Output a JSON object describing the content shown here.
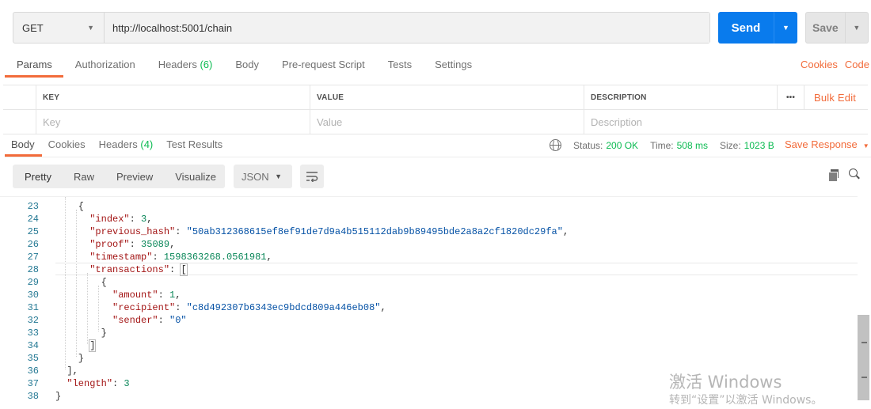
{
  "request": {
    "method": "GET",
    "url": "http://localhost:5001/chain",
    "send_label": "Send",
    "save_label": "Save"
  },
  "request_tabs": [
    {
      "label": "Params"
    },
    {
      "label": "Authorization"
    },
    {
      "label": "Headers",
      "count": "(6)"
    },
    {
      "label": "Body"
    },
    {
      "label": "Pre-request Script"
    },
    {
      "label": "Tests"
    },
    {
      "label": "Settings"
    }
  ],
  "request_tabs_right": {
    "cookies": "Cookies",
    "code": "Code"
  },
  "params": {
    "headers": {
      "key": "KEY",
      "value": "VALUE",
      "description": "DESCRIPTION"
    },
    "more": "•••",
    "bulk_edit": "Bulk Edit",
    "placeholders": {
      "key": "Key",
      "value": "Value",
      "description": "Description"
    }
  },
  "response_tabs": [
    {
      "label": "Body"
    },
    {
      "label": "Cookies"
    },
    {
      "label": "Headers",
      "count": "(4)"
    },
    {
      "label": "Test Results"
    }
  ],
  "response_meta": {
    "status_label": "Status:",
    "status_value": "200 OK",
    "time_label": "Time:",
    "time_value": "508 ms",
    "size_label": "Size:",
    "size_value": "1023 B",
    "save_response": "Save Response"
  },
  "view_modes": [
    "Pretty",
    "Raw",
    "Preview",
    "Visualize"
  ],
  "format": "JSON",
  "code_lines": [
    {
      "num": "23",
      "text": "    {"
    },
    {
      "num": "24",
      "text": "      \"index\": 3,"
    },
    {
      "num": "25",
      "text": "      \"previous_hash\": \"50ab312368615ef8ef91de7d9a4b515112dab9b89495bde2a8a2cf1820dc29fa\","
    },
    {
      "num": "26",
      "text": "      \"proof\": 35089,"
    },
    {
      "num": "27",
      "text": "      \"timestamp\": 1598363268.0561981,"
    },
    {
      "num": "28",
      "text": "      \"transactions\": ["
    },
    {
      "num": "29",
      "text": "        {"
    },
    {
      "num": "30",
      "text": "          \"amount\": 1,"
    },
    {
      "num": "31",
      "text": "          \"recipient\": \"c8d492307b6343ec9bdcd809a446eb08\","
    },
    {
      "num": "32",
      "text": "          \"sender\": \"0\""
    },
    {
      "num": "33",
      "text": "        }"
    },
    {
      "num": "34",
      "text": "      ]"
    },
    {
      "num": "35",
      "text": "    }"
    },
    {
      "num": "36",
      "text": "  ],"
    },
    {
      "num": "37",
      "text": "  \"length\": 3"
    },
    {
      "num": "38",
      "text": "}"
    }
  ],
  "watermark": {
    "line1": "激活 Windows",
    "line2": "转到“设置”以激活 Windows。"
  },
  "colors": {
    "accent": "#f26b3a",
    "send": "#097bed",
    "status_ok": "#0cbb52",
    "json_key": "#a31515",
    "json_string": "#0451a5",
    "json_number": "#098658"
  }
}
